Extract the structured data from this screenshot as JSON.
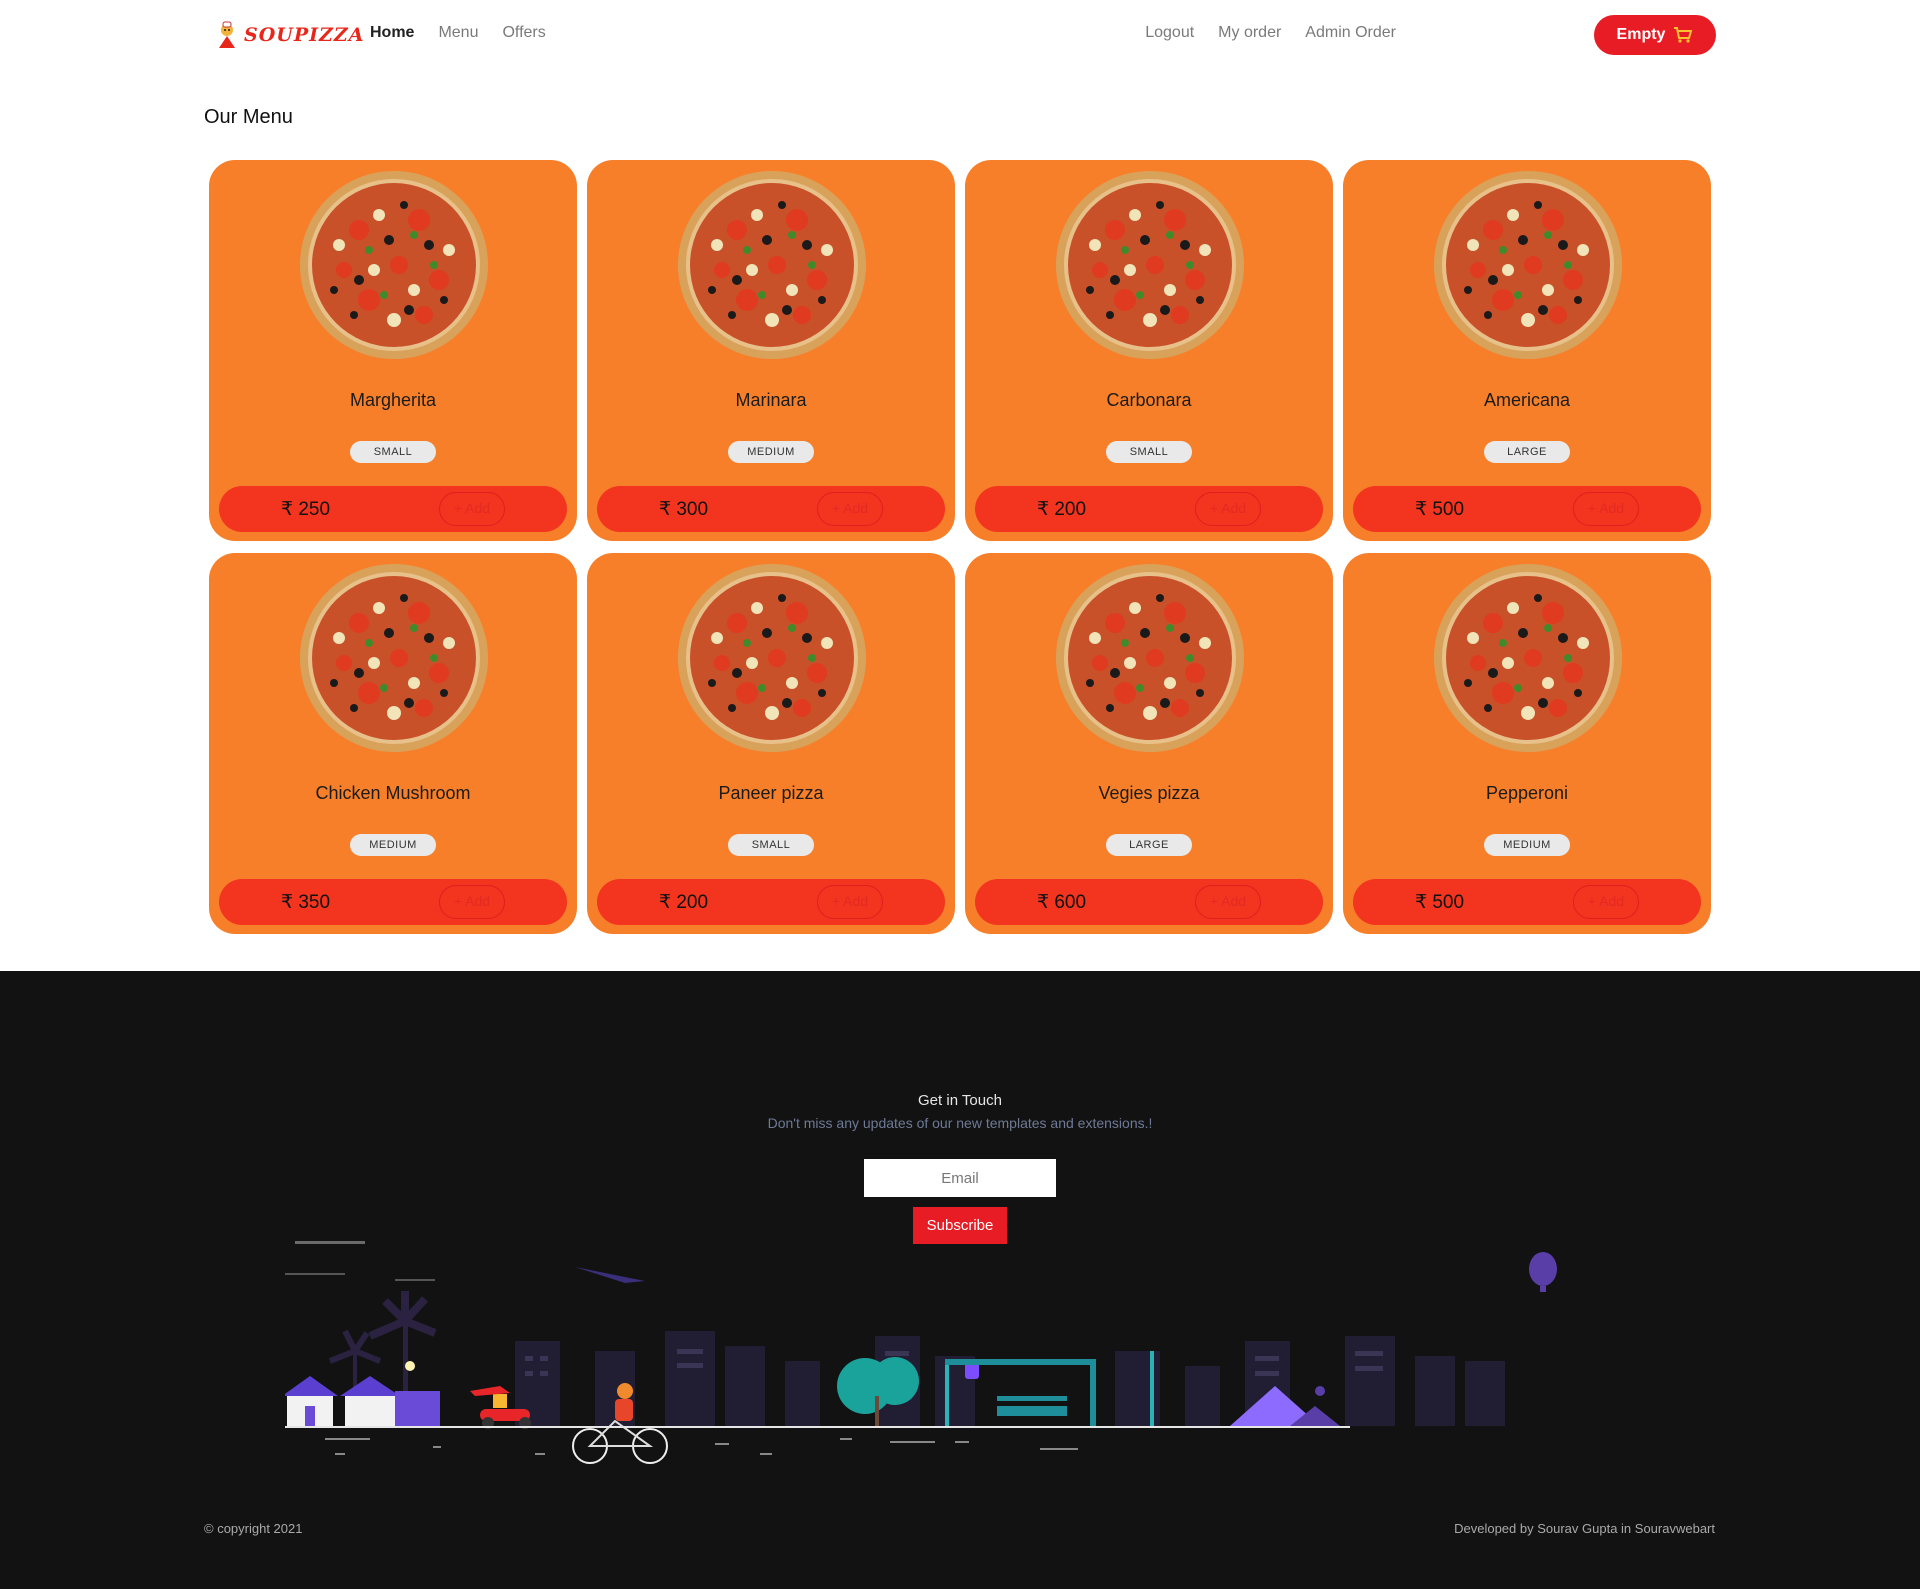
{
  "brand": {
    "name": "SOUPIZZA"
  },
  "nav": {
    "left": [
      {
        "label": "Home"
      },
      {
        "label": "Menu"
      },
      {
        "label": "Offers"
      }
    ],
    "right": [
      {
        "label": "Logout"
      },
      {
        "label": "My order"
      },
      {
        "label": "Admin Order"
      }
    ],
    "cart_label": "Empty"
  },
  "menu": {
    "title": "Our Menu",
    "add_label": "+ Add",
    "items": [
      {
        "name": "Margherita",
        "size": "SMALL",
        "price": "₹ 250"
      },
      {
        "name": "Marinara",
        "size": "MEDIUM",
        "price": "₹ 300"
      },
      {
        "name": "Carbonara",
        "size": "SMALL",
        "price": "₹ 200"
      },
      {
        "name": "Americana",
        "size": "LARGE",
        "price": "₹ 500"
      },
      {
        "name": "Chicken Mushroom",
        "size": "MEDIUM",
        "price": "₹ 350"
      },
      {
        "name": "Paneer pizza",
        "size": "SMALL",
        "price": "₹ 200"
      },
      {
        "name": "Vegies pizza",
        "size": "LARGE",
        "price": "₹ 600"
      },
      {
        "name": "Pepperoni",
        "size": "MEDIUM",
        "price": "₹ 500"
      }
    ]
  },
  "footer": {
    "title": "Get in Touch",
    "subtitle": "Don't miss any updates of our new templates and extensions.!",
    "email_placeholder": "Email",
    "subscribe_label": "Subscribe",
    "copyright": "© copyright 2021",
    "developer": "Developed by Sourav Gupta in Souravwebart"
  },
  "colors": {
    "accent": "#e81c24",
    "card": "#f77f2a",
    "price_bar": "#f3341f",
    "footer_bg": "#121212"
  }
}
